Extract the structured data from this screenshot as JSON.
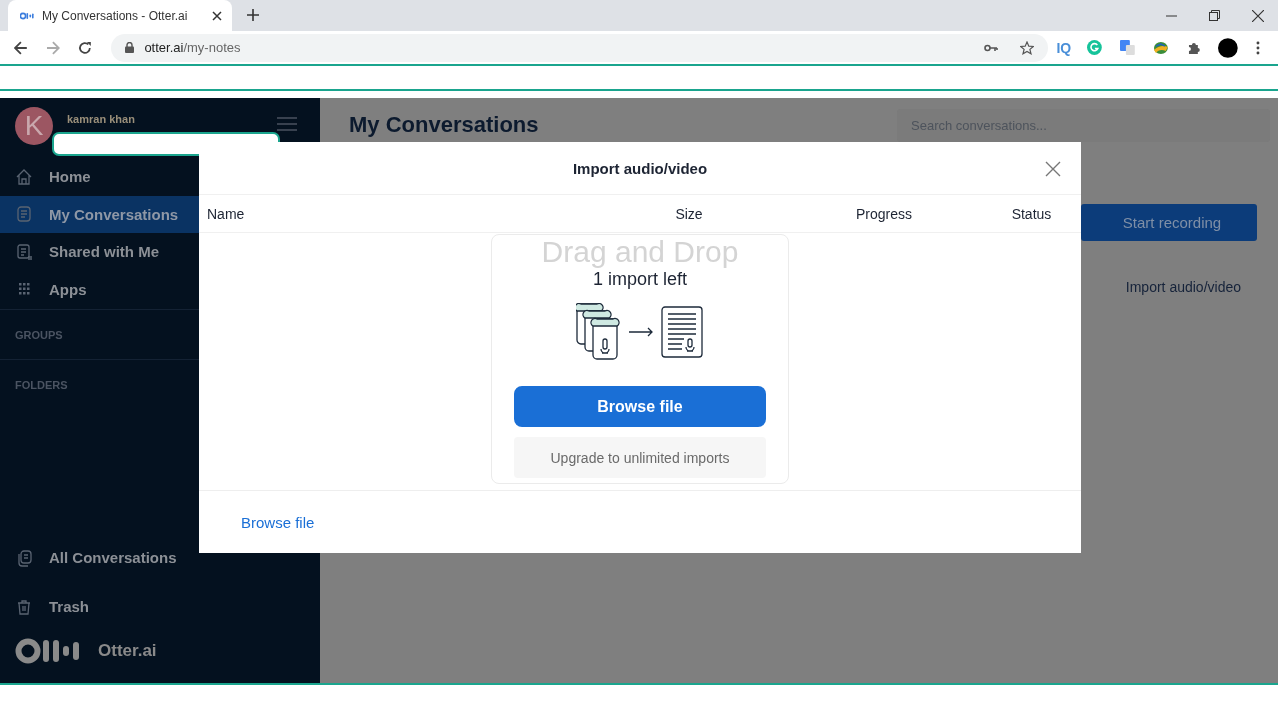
{
  "browser": {
    "tab_title": "My Conversations - Otter.ai",
    "url_host": "otter.ai",
    "url_path": "/my-notes",
    "extension_label": "IQ"
  },
  "sidebar": {
    "user_name": "kamran khan",
    "avatar_letter": "K",
    "items": [
      {
        "label": "Home",
        "selected": false
      },
      {
        "label": "My Conversations",
        "selected": true
      },
      {
        "label": "Shared with Me",
        "selected": false
      },
      {
        "label": "Apps",
        "selected": false
      }
    ],
    "sections": [
      "GROUPS",
      "FOLDERS"
    ],
    "bottom_items": [
      "All Conversations",
      "Trash"
    ],
    "brand": "Otter.ai"
  },
  "main": {
    "title": "My Conversations",
    "search": {
      "placeholder": "Search conversations..."
    },
    "record_button": "Start recording",
    "import_link": "Import audio/video"
  },
  "dialog": {
    "title": "Import audio/video",
    "columns": [
      "Name",
      "Size",
      "Progress",
      "Status"
    ],
    "drop_zone": {
      "backdrop_text": "Drag and Drop",
      "quota": "1 import left",
      "browse_button": "Browse file",
      "upgrade_button": "Upgrade to unlimited imports"
    },
    "footer_link": "Browse file"
  }
}
